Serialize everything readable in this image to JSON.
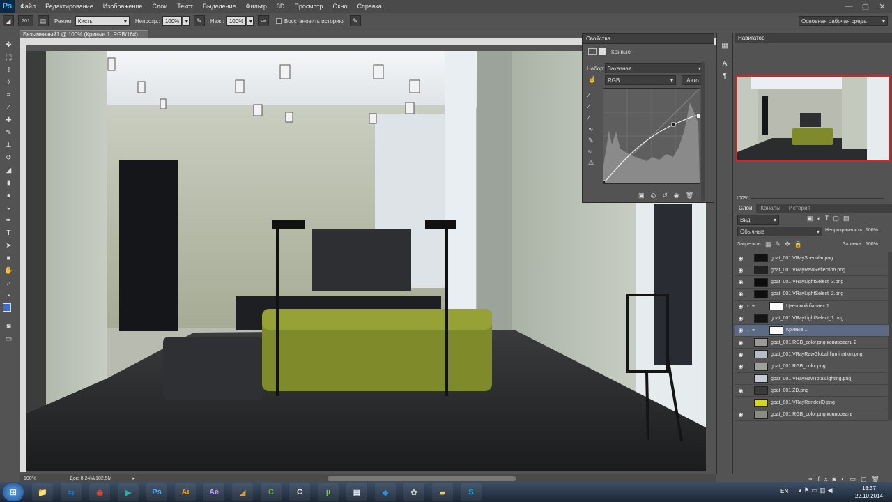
{
  "app": {
    "logo": "Ps"
  },
  "menu": [
    "Файл",
    "Редактирование",
    "Изображение",
    "Слои",
    "Текст",
    "Выделение",
    "Фильтр",
    "3D",
    "Просмотр",
    "Окно",
    "Справка"
  ],
  "window_controls": [
    "—",
    "▢",
    "✕"
  ],
  "options": {
    "brush_size": "201",
    "mode_label": "Режим:",
    "mode_value": "Кисть",
    "opacity_label": "Непрозр.:",
    "opacity_value": "100%",
    "pressure_label": "Наж.:",
    "pressure_value": "100%",
    "history_label": "Восстановить историю",
    "workspace": "Основная рабочая среда"
  },
  "document": {
    "tab_title": "Безымянный1 @ 100% (Кривые 1, RGB/16#) *",
    "close": "×"
  },
  "status": {
    "zoom": "100%",
    "doc_size": "Док: 8,24М/102,5М",
    "arrow": "▸"
  },
  "properties": {
    "title": "Свойства",
    "subtitle": "Кривые",
    "preset_label": "Набор:",
    "preset_value": "Заказная",
    "channel_value": "RGB",
    "auto_label": "Авто"
  },
  "navigator": {
    "title": "Навигатор",
    "zoom": "100%"
  },
  "layers_panel": {
    "tabs": [
      "Слои",
      "Каналы",
      "История"
    ],
    "filter_label": "Вид",
    "blend_mode": "Обычные",
    "opacity_label": "Непрозрачность:",
    "opacity_value": "100%",
    "lock_label": "Закрепить:",
    "fill_label": "Заливка:",
    "fill_value": "100%",
    "layers": [
      {
        "name": "goat_001.VRaySpecular.png",
        "thumb": "#111",
        "visible": true,
        "selected": false
      },
      {
        "name": "goat_001.VRayRawReflection.png",
        "thumb": "#222",
        "visible": true,
        "selected": false
      },
      {
        "name": "goat_001.VRayLightSelect_3.png",
        "thumb": "#0c0c0c",
        "visible": true,
        "selected": false
      },
      {
        "name": "goat_001.VRayLightSelect_2.png",
        "thumb": "#0e0e0e",
        "visible": true,
        "selected": false
      },
      {
        "name": "Цветовой баланс 1",
        "thumb": "#ffffff",
        "visible": true,
        "selected": false,
        "adjustment": true
      },
      {
        "name": "goat_001.VRayLightSelect_1.png",
        "thumb": "#151515",
        "visible": true,
        "selected": false
      },
      {
        "name": "Кривые 1",
        "thumb": "#ffffff",
        "visible": true,
        "selected": true,
        "adjustment": true
      },
      {
        "name": "goat_001.RGB_color.png копировать 2",
        "thumb": "#9a9a96",
        "visible": true,
        "selected": false
      },
      {
        "name": "goat_001.VRayRawGlobalIllumination.png",
        "thumb": "#b8bcc6",
        "visible": true,
        "selected": false
      },
      {
        "name": "goat_001.RGB_color.png",
        "thumb": "#a0a29c",
        "visible": true,
        "selected": false
      },
      {
        "name": "goat_001.VRayRawTotalLighting.png",
        "thumb": "#c8ccd6",
        "visible": false,
        "selected": false
      },
      {
        "name": "goat_001.ZD.png",
        "thumb": "#3a3a3a",
        "visible": true,
        "selected": false
      },
      {
        "name": "goat_001.VRayRenderID.png",
        "thumb": "#d6d622",
        "visible": false,
        "selected": false
      },
      {
        "name": "goat_001.RGB_color.png копировать",
        "thumb": "#8a8c86",
        "visible": true,
        "selected": false
      }
    ]
  },
  "taskbar": {
    "lang": "EN",
    "time": "18:37",
    "date": "22.10.2014",
    "apps": [
      {
        "icon": "explorer-icon",
        "label": "📁",
        "color": "#f2c84b"
      },
      {
        "icon": "teamviewer-icon",
        "label": "⇆",
        "color": "#1a73c8"
      },
      {
        "icon": "chrome-icon",
        "label": "◉",
        "color": "#e34133"
      },
      {
        "icon": "app-icon",
        "label": "▶",
        "color": "#2bb0a0"
      },
      {
        "icon": "photoshop-icon",
        "label": "Ps",
        "color": "#4fb3ff"
      },
      {
        "icon": "illustrator-icon",
        "label": "Ai",
        "color": "#ff9a00"
      },
      {
        "icon": "after-effects-icon",
        "label": "Ae",
        "color": "#c9a0ff"
      },
      {
        "icon": "archicad-icon",
        "label": "◢",
        "color": "#d8a03a"
      },
      {
        "icon": "corel-icon",
        "label": "C",
        "color": "#6ab04c"
      },
      {
        "icon": "sketchup-icon",
        "label": "C",
        "color": "#eeeeee"
      },
      {
        "icon": "utorrent-icon",
        "label": "µ",
        "color": "#7dc242"
      },
      {
        "icon": "notepad-icon",
        "label": "▤",
        "color": "#dfe7f2"
      },
      {
        "icon": "dropbox-icon",
        "label": "◆",
        "color": "#2d8fe0"
      },
      {
        "icon": "network-icon",
        "label": "✿",
        "color": "#cccccc"
      },
      {
        "icon": "folder-icon",
        "label": "▰",
        "color": "#e8d36a"
      },
      {
        "icon": "skype-icon",
        "label": "S",
        "color": "#00aff0"
      }
    ]
  },
  "colors": {
    "accent": "#3a6bd8",
    "selected_layer": "#5c6a84",
    "nav_frame": "#e02020"
  }
}
